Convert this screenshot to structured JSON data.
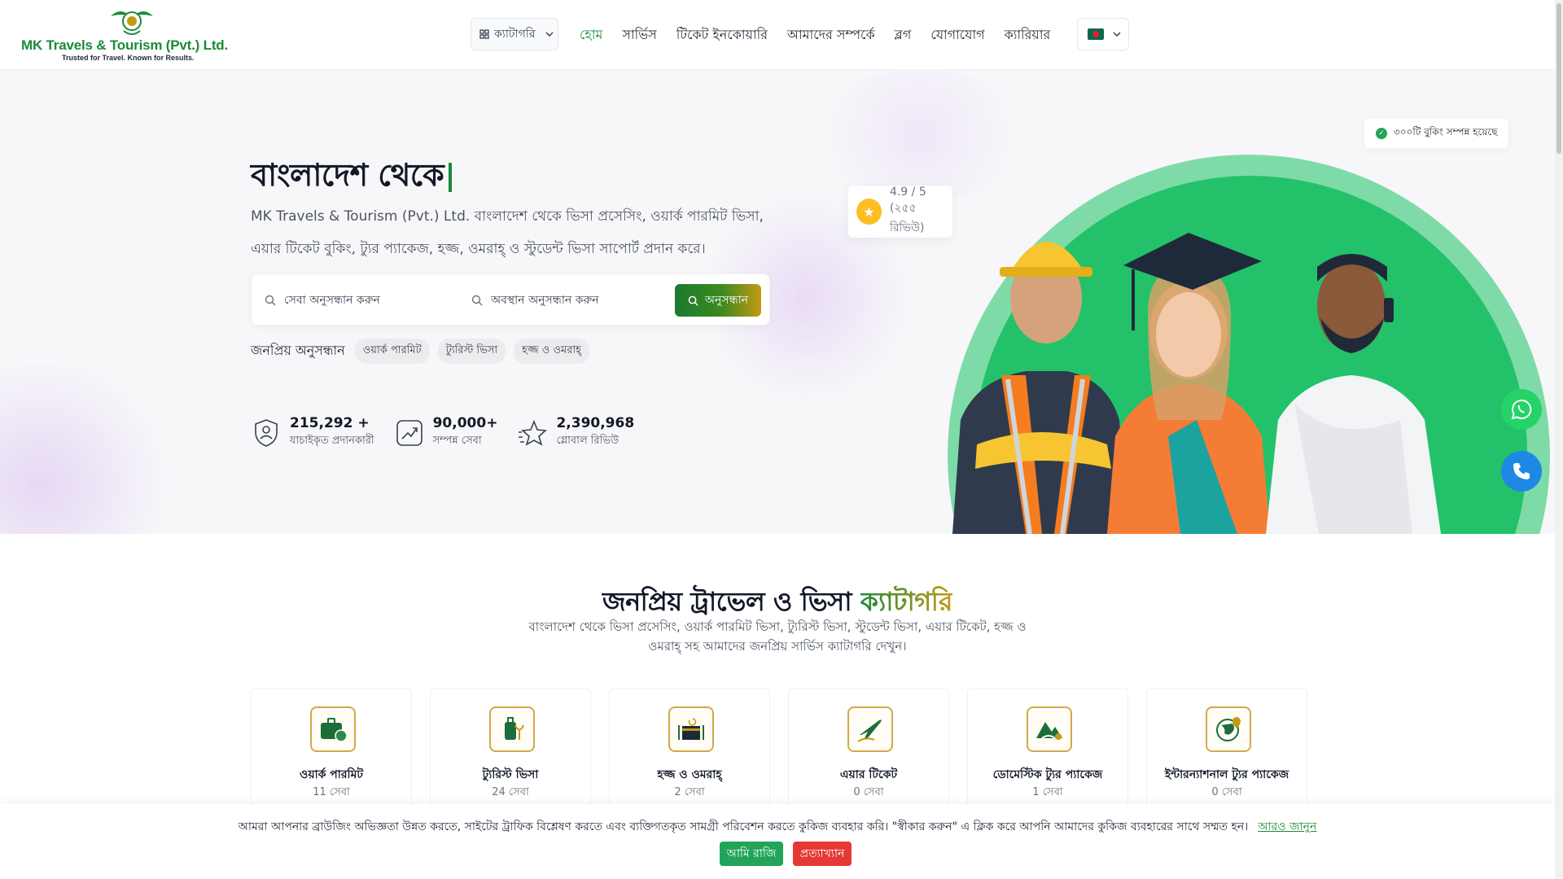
{
  "header": {
    "logo_name": "MK Travels & Tourism (Pvt.) Ltd.",
    "logo_tagline": "Trusted for Travel. Known for Results.",
    "category_button": "ক্যাটাগরি",
    "nav": [
      "হোম",
      "সার্ভিস",
      "টিকেট ইনকোয়ারি",
      "আমাদের সম্পর্কে",
      "ব্লগ",
      "যোগাযোগ",
      "ক্যারিয়ার"
    ],
    "active_nav": "হোম"
  },
  "hero": {
    "title": "বাংলাদেশ থেকে",
    "description": "MK Travels & Tourism (Pvt.) Ltd. বাংলাদেশ থেকে ভিসা প্রসেসিং, ওয়ার্ক পারমিট ভিসা, এয়ার টিকেট বুকিং, ট্যুর প্যাকেজ, হজ্জ, ওমরাহ্ ও স্টুডেন্ট ভিসা সাপোর্ট প্রদান করে।",
    "search": {
      "service_placeholder": "সেবা অনুসন্ধান করুন",
      "location_placeholder": "অবস্থান অনুসন্ধান করুন",
      "button": "অনুসন্ধান"
    },
    "popular_label": "জনপ্রিয় অনুসন্ধান",
    "popular_chips": [
      "ওয়ার্ক পারমিট",
      "ট্যুরিস্ট ভিসা",
      "হজ্জ ও ওমরাহ্"
    ],
    "stats": [
      {
        "value": "215,292 +",
        "caption": "যাচাইকৃত প্রদানকারী"
      },
      {
        "value": "90,000+",
        "caption": "সম্পন্ন সেবা"
      },
      {
        "value": "2,390,968",
        "caption": "গ্লোবাল রিভিউ"
      }
    ],
    "rating_value": "4.9 / 5",
    "rating_reviews": "(২৫৫ রিভিউ)",
    "booked_badge": "৩০০টি বুকিং সম্পন্ন হয়েছে"
  },
  "categories": {
    "title_main": "জনপ্রিয় ট্রাভেল ও ভিসা",
    "title_accent": "ক্যাটাগরি",
    "subtitle": "বাংলাদেশ থেকে ভিসা প্রসেসিং, ওয়ার্ক পারমিট ভিসা, ট্যুরিস্ট ভিসা, স্টুডেন্ট ভিসা, এয়ার টিকেট, হজ্জ ও ওমরাহ্ সহ আমাদের জনপ্রিয় সার্ভিস ক্যাটাগরি দেখুন।",
    "items": [
      {
        "name": "ওয়ার্ক পারমিট",
        "count": "11 সেবা",
        "icon": "briefcase-globe-icon"
      },
      {
        "name": "ট্যুরিস্ট ভিসা",
        "count": "24 সেবা",
        "icon": "luggage-palm-icon"
      },
      {
        "name": "হজ্জ ও ওমরাহ্",
        "count": "2 সেবা",
        "icon": "kaaba-icon"
      },
      {
        "name": "এয়ার টিকেট",
        "count": "0 সেবা",
        "icon": "airplane-icon"
      },
      {
        "name": "ডোমেস্টিক ট্যুর প্যাকেজ",
        "count": "1 সেবা",
        "icon": "mountain-pin-icon"
      },
      {
        "name": "ইন্টারন্যাশনাল ট্যুর প্যাকেজ",
        "count": "0 সেবা",
        "icon": "globe-pin-icon"
      }
    ]
  },
  "cookie": {
    "message": "আমরা আপনার ব্রাউজিং অভিজ্ঞতা উন্নত করতে, সাইটের ট্রাফিক বিশ্লেষণ করতে এবং ব্যক্তিগতকৃত সামগ্রী পরিবেশন করতে কুকিজ ব্যবহার করি। \"স্বীকার করুন\" এ ক্লিক করে আপনি আমাদের কুকিজ ব্যবহারের সাথে সম্মত হন।",
    "learn_more": "আরও জানুন",
    "accept": "আমি রাজি",
    "reject": "প্রত্যাখ্যান"
  },
  "colors": {
    "brand_green": "#1b8a3a",
    "gold": "#c49a12",
    "whatsapp": "#25d366",
    "phone": "#1e88e5",
    "reject_red": "#e53935"
  }
}
